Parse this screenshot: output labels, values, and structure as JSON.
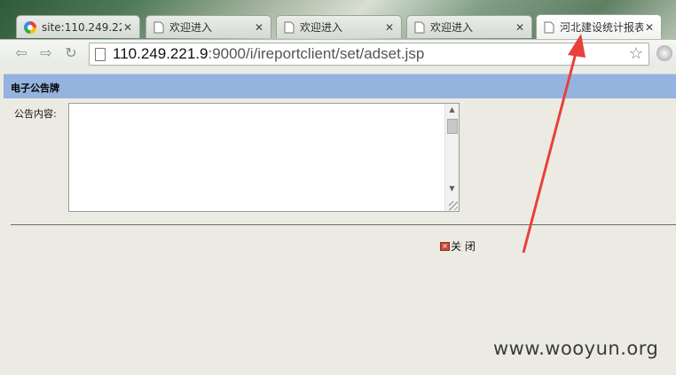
{
  "browser": {
    "tabs": [
      {
        "title": "site:110.249.221",
        "favicon": "google-icon",
        "active": false
      },
      {
        "title": "欢迎进入",
        "favicon": "page-icon",
        "active": false
      },
      {
        "title": "欢迎进入",
        "favicon": "page-icon",
        "active": false
      },
      {
        "title": "欢迎进入",
        "favicon": "page-icon",
        "active": false
      },
      {
        "title": "河北建设统计报表",
        "favicon": "page-icon",
        "active": true
      }
    ],
    "address": {
      "host": "110.249.221.9",
      "rest": ":9000/i/ireportclient/set/adset.jsp"
    }
  },
  "page": {
    "header_title": "电子公告牌",
    "content_label": "公告内容:",
    "content_value": "",
    "close_label": "关 闭"
  },
  "watermark": "www.wooyun.org",
  "colors": {
    "header_bg": "#95b3df",
    "page_bg": "#ecebe3",
    "arrow": "#e8413a"
  }
}
